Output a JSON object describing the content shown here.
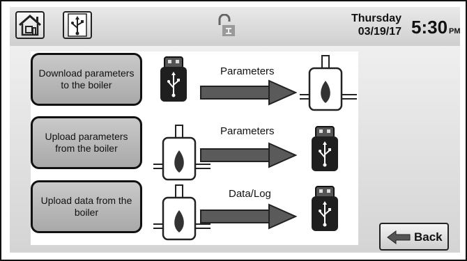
{
  "header": {
    "day": "Thursday",
    "date": "03/19/17",
    "time": "5:30",
    "ampm": "PM"
  },
  "actions": [
    {
      "label": "Download parameters to the boiler",
      "flow_label": "Parameters"
    },
    {
      "label": "Upload parameters from the boiler",
      "flow_label": "Parameters"
    },
    {
      "label": "Upload data from the boiler",
      "flow_label": "Data/Log"
    }
  ],
  "back": {
    "label": "Back"
  }
}
